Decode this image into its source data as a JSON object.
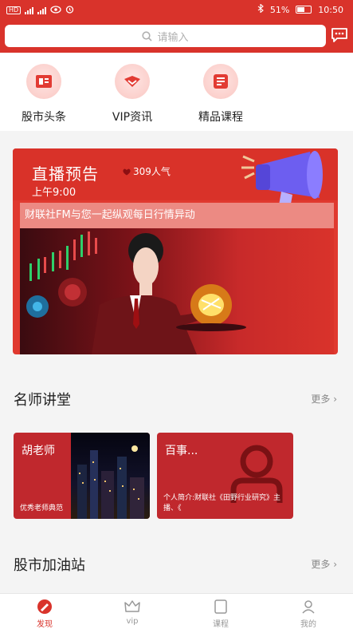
{
  "status_bar": {
    "battery": "51%",
    "time": "10:50"
  },
  "search": {
    "placeholder": "请输入"
  },
  "quick_nav": [
    {
      "label": "股市头条"
    },
    {
      "label": "VIP资讯"
    },
    {
      "label": "精品课程"
    }
  ],
  "banner": {
    "title": "直播预告",
    "popularity": "309人气",
    "time": "上午9:00",
    "subtitle": "财联社FM与您一起纵观每日行情异动"
  },
  "teachers_section": {
    "title": "名师讲堂",
    "more": "更多",
    "cards": [
      {
        "name": "胡老师",
        "desc": "优秀老师典范"
      },
      {
        "name": "百事...",
        "desc": "个人简介:财联社《田野行业研究》主播、《"
      }
    ]
  },
  "station_section": {
    "title": "股市加油站",
    "more": "更多"
  },
  "tabbar": {
    "tabs": [
      {
        "label": "发现",
        "active": true
      },
      {
        "label": "vip",
        "active": false
      },
      {
        "label": "课程",
        "active": false
      },
      {
        "label": "我的",
        "active": false
      }
    ]
  },
  "colors": {
    "brand": "#d9332b",
    "card": "#c0282d"
  }
}
